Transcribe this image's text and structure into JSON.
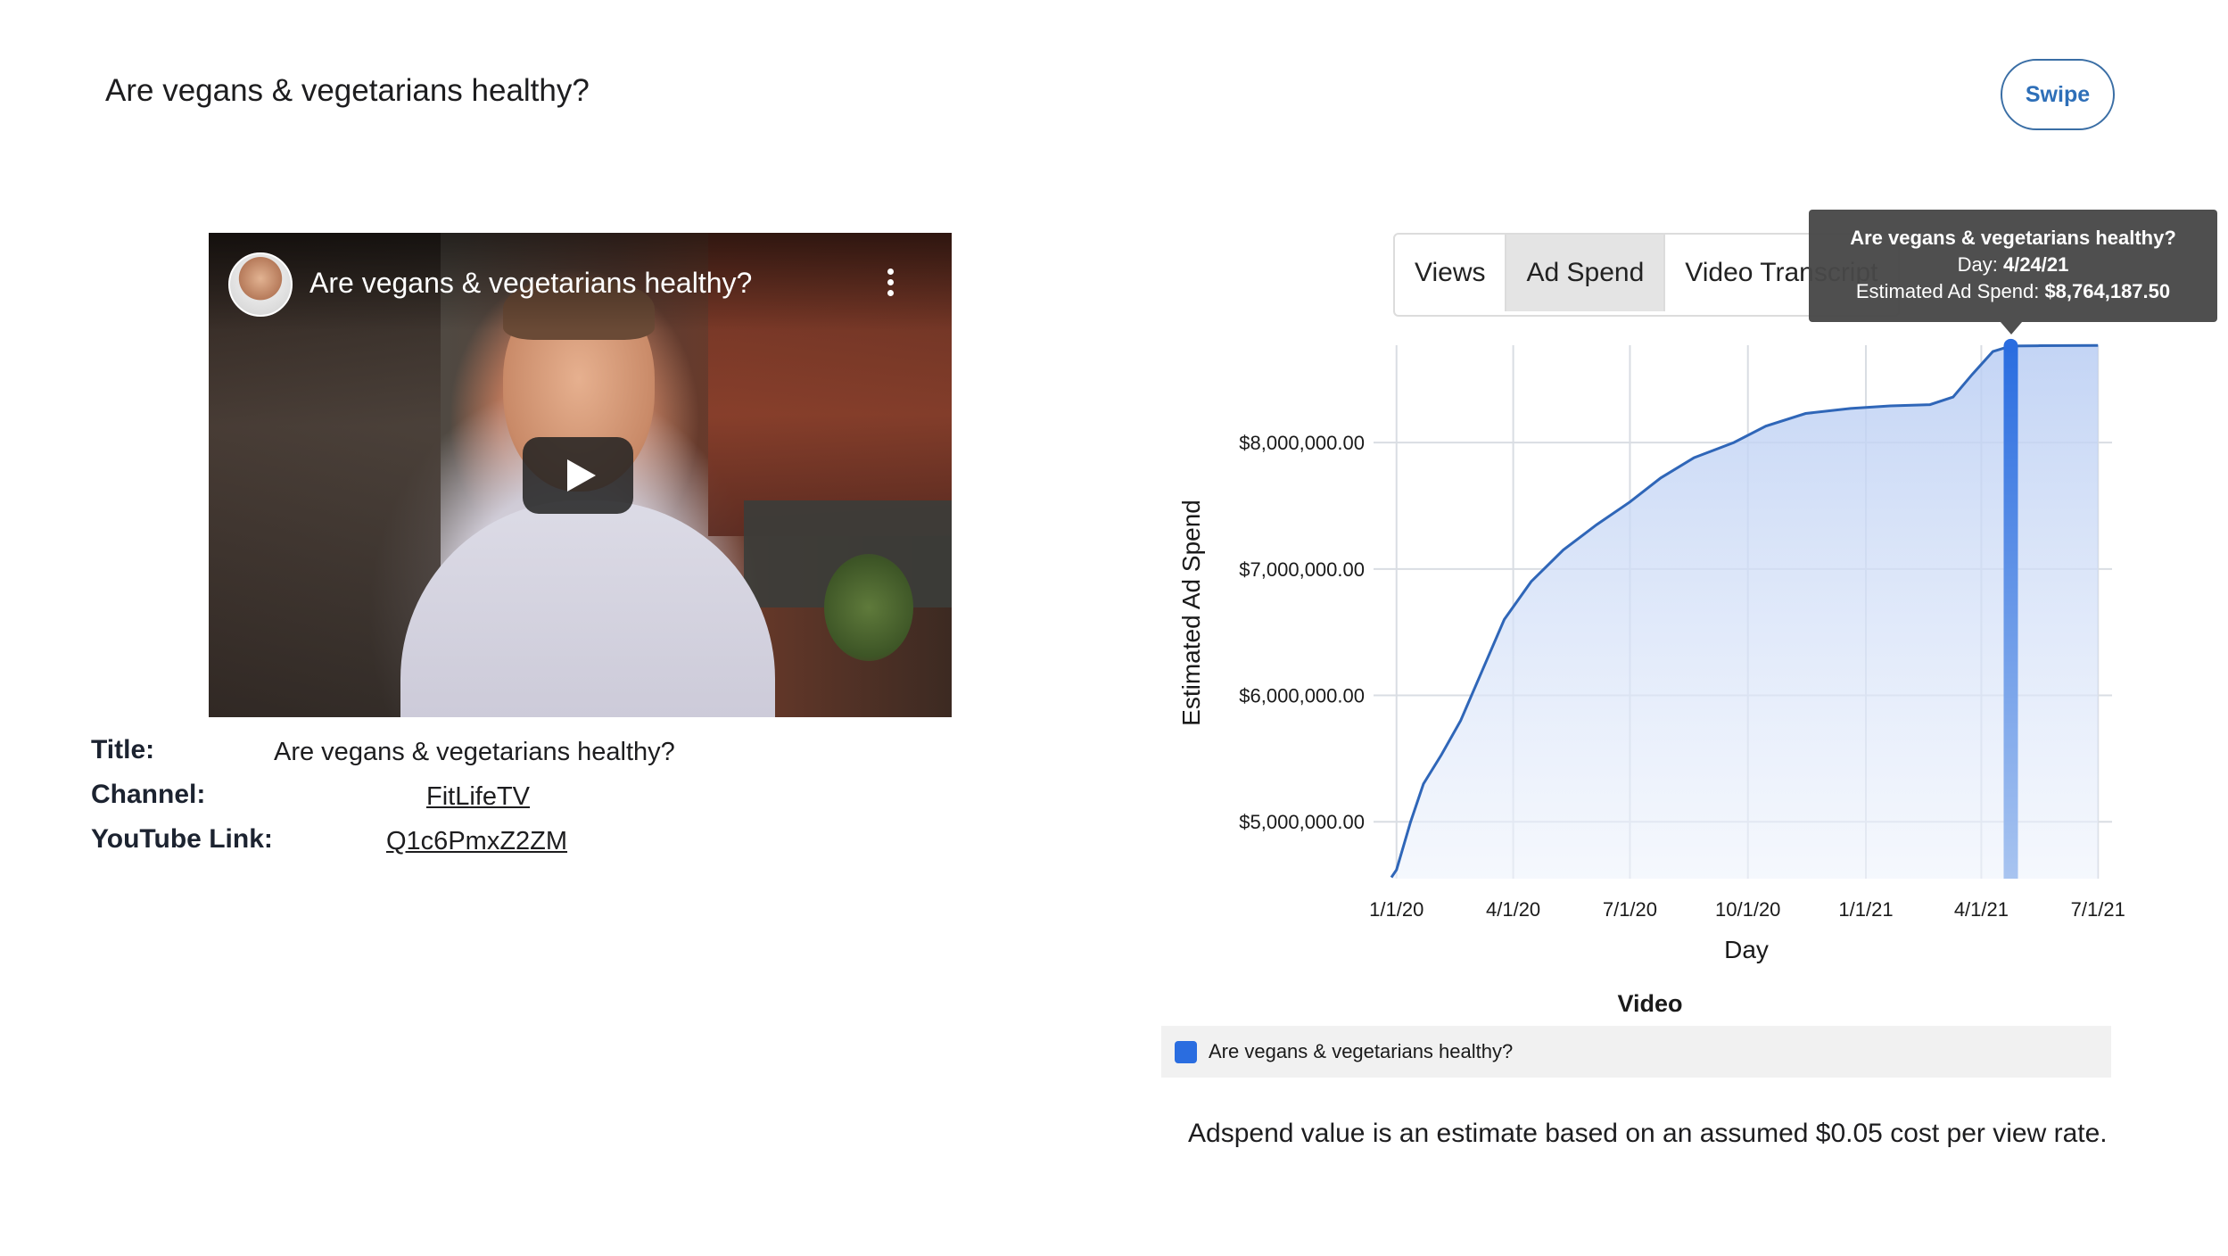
{
  "page": {
    "title": "Are vegans & vegetarians healthy?",
    "swipe_label": "Swipe"
  },
  "player": {
    "title": "Are vegans & vegetarians healthy?",
    "menu_icon": "more-vert-icon",
    "play_icon": "play-icon"
  },
  "meta": {
    "title_label": "Title:",
    "title_value": "Are vegans & vegetarians healthy?",
    "channel_label": "Channel:",
    "channel_value": "FitLifeTV",
    "link_label": "YouTube Link:",
    "link_value": "Q1c6PmxZ2ZM"
  },
  "tabs": [
    {
      "label": "Views"
    },
    {
      "label": "Ad Spend",
      "active": true
    },
    {
      "label": "Video Transcript"
    }
  ],
  "tooltip": {
    "title": "Are vegans & vegetarians healthy?",
    "day_label": "Day: ",
    "day_value": "4/24/21",
    "spend_label": "Estimated Ad Spend: ",
    "spend_value": "$8,764,187.50"
  },
  "legend": {
    "heading": "Video",
    "series_label": "Are vegans & vegetarians healthy?",
    "swatch_color": "#2a6de0"
  },
  "footnote": "Adspend value is an estimate based on an assumed $0.05 cost per view rate.",
  "chart_data": {
    "type": "area",
    "xlabel": "Day",
    "ylabel": "Estimated Ad Spend",
    "x_ticks": [
      "1/1/20",
      "4/1/20",
      "7/1/20",
      "10/1/20",
      "1/1/21",
      "4/1/21",
      "7/1/21"
    ],
    "y_ticks": [
      {
        "value": 5000000,
        "label": "$5,000,000.00"
      },
      {
        "value": 6000000,
        "label": "$6,000,000.00"
      },
      {
        "value": 7000000,
        "label": "$7,000,000.00"
      },
      {
        "value": 8000000,
        "label": "$8,000,000.00"
      }
    ],
    "ylim": [
      4550000,
      8770000
    ],
    "grid": true,
    "highlight": {
      "x": "2021-04-24",
      "y": 8764187.5
    },
    "series": [
      {
        "name": "Are vegans & vegetarians healthy?",
        "color": "#2f66b8",
        "points": [
          {
            "x": "2019-12-28",
            "y": 4560000
          },
          {
            "x": "2020-01-01",
            "y": 4620000
          },
          {
            "x": "2020-01-12",
            "y": 5000000
          },
          {
            "x": "2020-01-22",
            "y": 5300000
          },
          {
            "x": "2020-02-05",
            "y": 5530000
          },
          {
            "x": "2020-02-20",
            "y": 5800000
          },
          {
            "x": "2020-03-08",
            "y": 6200000
          },
          {
            "x": "2020-03-25",
            "y": 6600000
          },
          {
            "x": "2020-04-15",
            "y": 6900000
          },
          {
            "x": "2020-05-10",
            "y": 7150000
          },
          {
            "x": "2020-06-05",
            "y": 7350000
          },
          {
            "x": "2020-07-01",
            "y": 7530000
          },
          {
            "x": "2020-07-25",
            "y": 7720000
          },
          {
            "x": "2020-08-20",
            "y": 7880000
          },
          {
            "x": "2020-09-20",
            "y": 8000000
          },
          {
            "x": "2020-10-15",
            "y": 8130000
          },
          {
            "x": "2020-11-15",
            "y": 8230000
          },
          {
            "x": "2020-12-20",
            "y": 8270000
          },
          {
            "x": "2021-01-20",
            "y": 8290000
          },
          {
            "x": "2021-02-20",
            "y": 8300000
          },
          {
            "x": "2021-03-10",
            "y": 8360000
          },
          {
            "x": "2021-03-25",
            "y": 8540000
          },
          {
            "x": "2021-04-10",
            "y": 8720000
          },
          {
            "x": "2021-04-24",
            "y": 8764187.5
          },
          {
            "x": "2021-05-15",
            "y": 8766000
          },
          {
            "x": "2021-07-01",
            "y": 8768000
          }
        ]
      }
    ]
  }
}
